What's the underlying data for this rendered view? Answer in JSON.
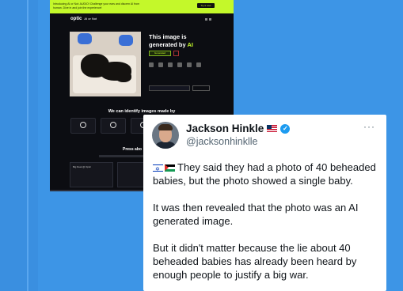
{
  "embedded_site": {
    "banner_text": "Introducing AI or Not: AUDIO! Challenge your ears and discern AI from human. Dive in and join the experience!",
    "banner_button": "Try it now",
    "logo": "optic",
    "logo_sub": "AI or Not",
    "result_title_prefix": "This image is",
    "result_title_mid": "generated by",
    "result_title_ai": "AI",
    "result_tag": "Generated",
    "identify_heading": "We can identify images made by",
    "press_heading": "Press abo",
    "news_items": [
      "Big Deal @ Optic",
      "",
      ""
    ]
  },
  "tweet": {
    "display_name": "Jackson Hinkle",
    "handle": "@jacksonhinklle",
    "more_icon": "more-icon",
    "paragraphs": [
      "They said they had a photo of 40 beheaded babies, but the photo showed a single baby.",
      "It was then revealed that the photo was an AI generated image.",
      "But it didn't matter because the lie about 40 beheaded babies has already been heard by enough people to justify a big war."
    ],
    "colors": {
      "verified": "#1d9bf0",
      "text": "#0f1419",
      "muted": "#536471"
    }
  },
  "colors": {
    "background": "#3d95e6",
    "site_bg": "#0c0d12",
    "accent": "#c4f82a"
  }
}
